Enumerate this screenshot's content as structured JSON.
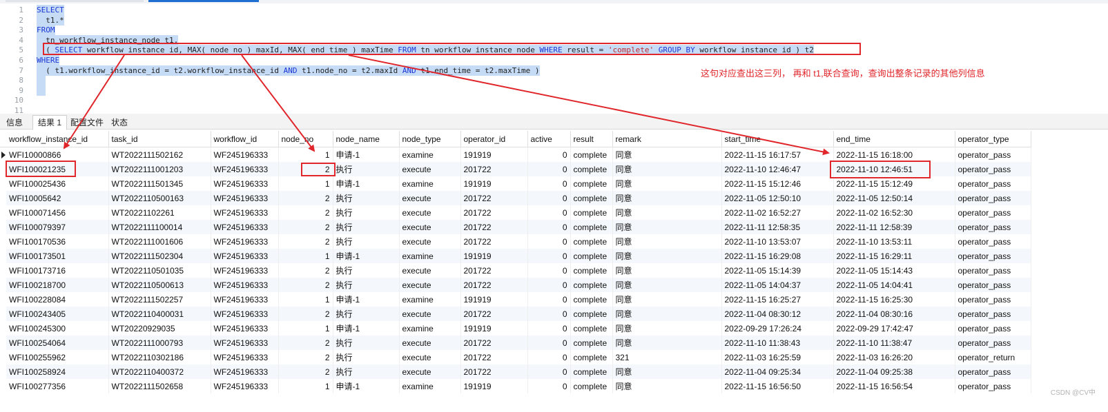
{
  "editor": {
    "lines": [
      {
        "n": "1",
        "segments": [
          {
            "t": "SELECT",
            "c": "kw"
          }
        ]
      },
      {
        "n": "2",
        "segments": [
          {
            "t": "  t1.*",
            "c": ""
          }
        ]
      },
      {
        "n": "3",
        "segments": [
          {
            "t": "FROM",
            "c": "kw"
          }
        ]
      },
      {
        "n": "4",
        "segments": [
          {
            "t": "  tn_workflow_instance_node t1,",
            "c": ""
          }
        ]
      },
      {
        "n": "5",
        "segments": [
          {
            "t": "  ( ",
            "c": ""
          },
          {
            "t": "SELECT",
            "c": "kw"
          },
          {
            "t": " workflow_instance_id, MAX( node_no ) maxId, MAX( end_time ) maxTime ",
            "c": ""
          },
          {
            "t": "FROM",
            "c": "kw"
          },
          {
            "t": " tn_workflow_instance_node ",
            "c": ""
          },
          {
            "t": "WHERE",
            "c": "kw"
          },
          {
            "t": " result = ",
            "c": ""
          },
          {
            "t": "'complete'",
            "c": "str"
          },
          {
            "t": " ",
            "c": ""
          },
          {
            "t": "GROUP BY",
            "c": "kw"
          },
          {
            "t": " workflow_instance_id ) t2",
            "c": ""
          }
        ]
      },
      {
        "n": "6",
        "segments": [
          {
            "t": "WHERE",
            "c": "kw"
          }
        ]
      },
      {
        "n": "7",
        "segments": [
          {
            "t": "  ( t1.workflow_instance_id = t2.workflow_instance_id ",
            "c": ""
          },
          {
            "t": "AND",
            "c": "kw"
          },
          {
            "t": " t1.node_no = t2.maxId ",
            "c": ""
          },
          {
            "t": "AND",
            "c": "kw"
          },
          {
            "t": " t1.end_time = t2.maxTime )",
            "c": ""
          }
        ]
      },
      {
        "n": "8",
        "segments": [
          {
            "t": "  ",
            "c": ""
          }
        ]
      },
      {
        "n": "9",
        "segments": [
          {
            "t": "  ",
            "c": ""
          }
        ]
      },
      {
        "n": "10",
        "segments": []
      },
      {
        "n": "11",
        "segments": []
      }
    ]
  },
  "annotation": "这句对应查出这三列，  再和 t1,联合查询，查询出整条记录的其他列信息",
  "tabs": [
    "信息",
    "结果 1",
    "配置文件",
    "状态"
  ],
  "table": {
    "columns": [
      "workflow_instance_id",
      "task_id",
      "workflow_id",
      "node_no",
      "node_name",
      "node_type",
      "operator_id",
      "active",
      "result",
      "remark",
      "start_time",
      "end_time",
      "operator_type"
    ],
    "rows": [
      [
        "WFI10000866",
        "WT2022111502162",
        "WF245196333",
        "1",
        "申请-1",
        "examine",
        "191919",
        "0",
        "complete",
        "同意",
        "2022-11-15 16:17:57",
        "2022-11-15 16:18:00",
        "operator_pass"
      ],
      [
        "WFI100021235",
        "WT2022111001203",
        "WF245196333",
        "2",
        "执行",
        "execute",
        "201722",
        "0",
        "complete",
        "同意",
        "2022-11-10 12:46:47",
        "2022-11-10 12:46:51",
        "operator_pass"
      ],
      [
        "WFI100025436",
        "WT2022111501345",
        "WF245196333",
        "1",
        "申请-1",
        "examine",
        "191919",
        "0",
        "complete",
        "同意",
        "2022-11-15 15:12:46",
        "2022-11-15 15:12:49",
        "operator_pass"
      ],
      [
        "WFI10005642",
        "WT2022110500163",
        "WF245196333",
        "2",
        "执行",
        "execute",
        "201722",
        "0",
        "complete",
        "同意",
        "2022-11-05 12:50:10",
        "2022-11-05 12:50:14",
        "operator_pass"
      ],
      [
        "WFI100071456",
        "WT20221102261",
        "WF245196333",
        "2",
        "执行",
        "execute",
        "201722",
        "0",
        "complete",
        "同意",
        "2022-11-02 16:52:27",
        "2022-11-02 16:52:30",
        "operator_pass"
      ],
      [
        "WFI100079397",
        "WT2022111100014",
        "WF245196333",
        "2",
        "执行",
        "execute",
        "201722",
        "0",
        "complete",
        "同意",
        "2022-11-11 12:58:35",
        "2022-11-11 12:58:39",
        "operator_pass"
      ],
      [
        "WFI100170536",
        "WT2022111001606",
        "WF245196333",
        "2",
        "执行",
        "execute",
        "201722",
        "0",
        "complete",
        "同意",
        "2022-11-10 13:53:07",
        "2022-11-10 13:53:11",
        "operator_pass"
      ],
      [
        "WFI100173501",
        "WT2022111502304",
        "WF245196333",
        "1",
        "申请-1",
        "examine",
        "191919",
        "0",
        "complete",
        "同意",
        "2022-11-15 16:29:08",
        "2022-11-15 16:29:11",
        "operator_pass"
      ],
      [
        "WFI100173716",
        "WT2022110501035",
        "WF245196333",
        "2",
        "执行",
        "execute",
        "201722",
        "0",
        "complete",
        "同意",
        "2022-11-05 15:14:39",
        "2022-11-05 15:14:43",
        "operator_pass"
      ],
      [
        "WFI100218700",
        "WT2022110500613",
        "WF245196333",
        "2",
        "执行",
        "execute",
        "201722",
        "0",
        "complete",
        "同意",
        "2022-11-05 14:04:37",
        "2022-11-05 14:04:41",
        "operator_pass"
      ],
      [
        "WFI100228084",
        "WT2022111502257",
        "WF245196333",
        "1",
        "申请-1",
        "examine",
        "191919",
        "0",
        "complete",
        "同意",
        "2022-11-15 16:25:27",
        "2022-11-15 16:25:30",
        "operator_pass"
      ],
      [
        "WFI100243405",
        "WT2022110400031",
        "WF245196333",
        "2",
        "执行",
        "execute",
        "201722",
        "0",
        "complete",
        "同意",
        "2022-11-04 08:30:12",
        "2022-11-04 08:30:16",
        "operator_pass"
      ],
      [
        "WFI100245300",
        "WT20220929035",
        "WF245196333",
        "1",
        "申请-1",
        "examine",
        "191919",
        "0",
        "complete",
        "同意",
        "2022-09-29 17:26:24",
        "2022-09-29 17:42:47",
        "operator_pass"
      ],
      [
        "WFI100254064",
        "WT2022111000793",
        "WF245196333",
        "2",
        "执行",
        "execute",
        "201722",
        "0",
        "complete",
        "同意",
        "2022-11-10 11:38:43",
        "2022-11-10 11:38:47",
        "operator_pass"
      ],
      [
        "WFI100255962",
        "WT2022110302186",
        "WF245196333",
        "2",
        "执行",
        "execute",
        "201722",
        "0",
        "complete",
        "321",
        "2022-11-03 16:25:59",
        "2022-11-03 16:26:20",
        "operator_return"
      ],
      [
        "WFI100258924",
        "WT2022110400372",
        "WF245196333",
        "2",
        "执行",
        "execute",
        "201722",
        "0",
        "complete",
        "同意",
        "2022-11-04 09:25:34",
        "2022-11-04 09:25:38",
        "operator_pass"
      ],
      [
        "WFI100277356",
        "WT2022111502658",
        "WF245196333",
        "1",
        "申请-1",
        "examine",
        "191919",
        "0",
        "complete",
        "同意",
        "2022-11-15 16:56:50",
        "2022-11-15 16:56:54",
        "operator_pass"
      ]
    ]
  },
  "watermark": "CSDN @CV中",
  "colors": {
    "annotation": "#e0262b",
    "keyword": "#1a35d6",
    "string": "#c4282c",
    "selection": "#c6dcf6"
  }
}
